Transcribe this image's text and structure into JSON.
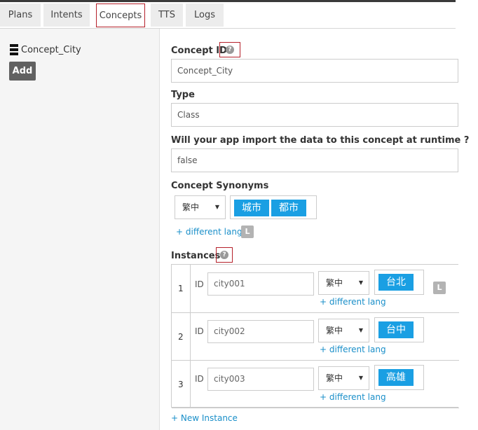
{
  "tabs": [
    {
      "label": "Plans",
      "active": false
    },
    {
      "label": "Intents",
      "active": false
    },
    {
      "label": "Concepts",
      "active": true
    },
    {
      "label": "TTS",
      "active": false
    },
    {
      "label": "Logs",
      "active": false
    }
  ],
  "sidebar": {
    "concept_name": "Concept_City",
    "add_label": "Add"
  },
  "form": {
    "concept_id": {
      "label": "Concept ID",
      "value": "Concept_City"
    },
    "type": {
      "label": "Type",
      "value": "Class"
    },
    "runtime_import": {
      "label": "Will your app import the data to this concept at runtime ?",
      "value": "false"
    },
    "synonyms": {
      "label": "Concept Synonyms",
      "lang": "繁中",
      "tags": [
        "城市",
        "都市"
      ],
      "different_lang": "+ different lang",
      "badge": "L"
    },
    "instances": {
      "label": "Instances",
      "id_label": "ID",
      "different_lang": "+ different lang",
      "badge": "L",
      "new_instance": "+ New Instance",
      "rows": [
        {
          "num": "1",
          "id": "city001",
          "lang": "繁中",
          "tag": "台北"
        },
        {
          "num": "2",
          "id": "city002",
          "lang": "繁中",
          "tag": "台中"
        },
        {
          "num": "3",
          "id": "city003",
          "lang": "繁中",
          "tag": "高雄"
        }
      ]
    }
  },
  "colors": {
    "accent": "#1a9fe3",
    "highlight_border": "#b5202a",
    "link": "#1a8fc9"
  }
}
